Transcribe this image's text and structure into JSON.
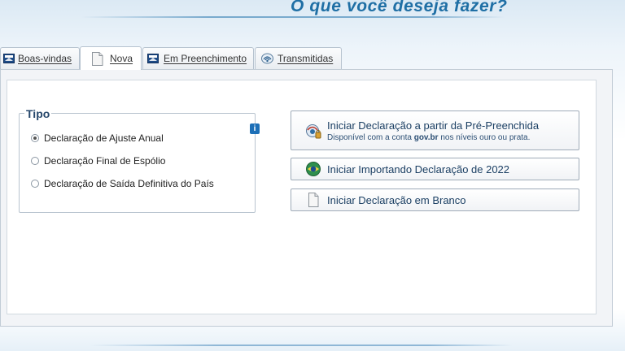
{
  "header": {
    "title": "O que você deseja fazer?"
  },
  "tabs": [
    {
      "label": "Boas-vindas",
      "icon": "window-logo-icon",
      "active": false
    },
    {
      "label": "Nova",
      "icon": "blank-document-icon",
      "active": true
    },
    {
      "label": "Em Preenchimento",
      "icon": "window-logo-icon",
      "active": false
    },
    {
      "label": "Transmitidas",
      "icon": "transmit-signal-icon",
      "active": false
    }
  ],
  "tipo": {
    "legend": "Tipo",
    "options": [
      {
        "label": "Declaração de Ajuste Anual",
        "selected": true
      },
      {
        "label": "Declaração Final de Espólio",
        "selected": false
      },
      {
        "label": "Declaração de Saída Definitiva do País",
        "selected": false
      }
    ],
    "info_icon": "i"
  },
  "actions": {
    "pre_preenchida": {
      "label": "Iniciar Declaração a partir da Pré-Preenchida",
      "note_prefix": "Disponível com a conta ",
      "note_bold": "gov.br",
      "note_suffix": " nos níveis ouro ou prata."
    },
    "importando": {
      "label": "Iniciar Importando Declaração de 2022"
    },
    "em_branco": {
      "label": "Iniciar Declaração em Branco"
    }
  },
  "colors": {
    "title": "#1f6fa5",
    "text_blue": "#1b3f63",
    "legend": "#26476b",
    "info_blue": "#1d6fb7"
  }
}
